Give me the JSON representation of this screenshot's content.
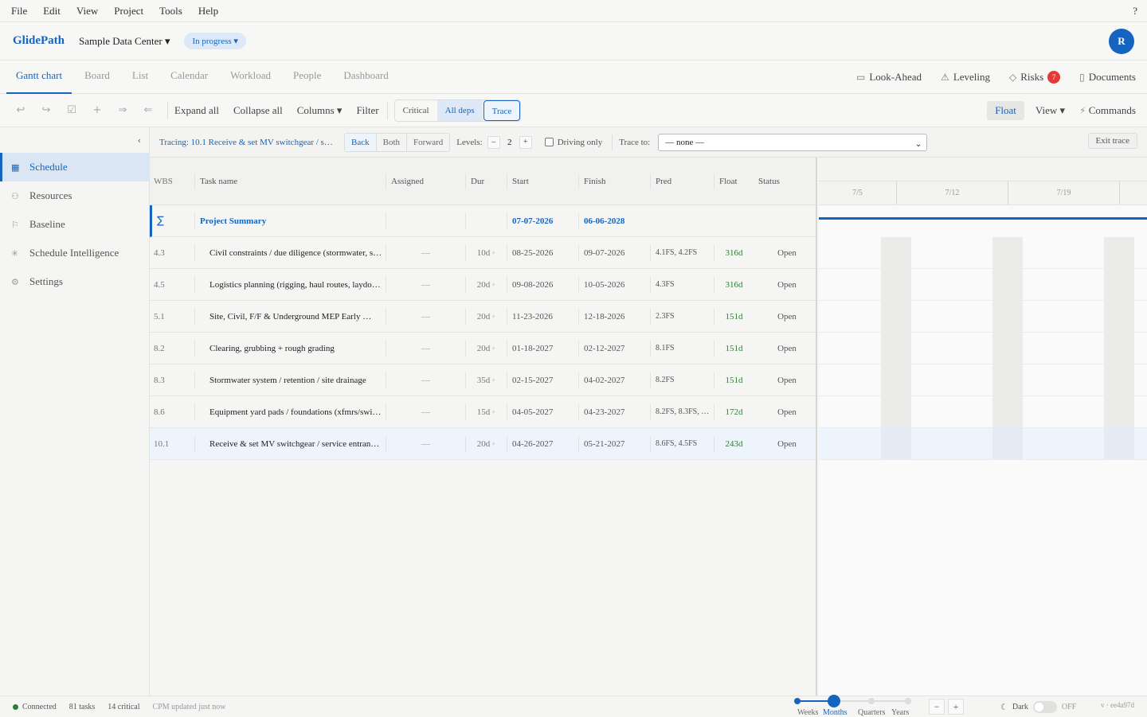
{
  "menu": {
    "items": [
      "File",
      "Edit",
      "View",
      "Project",
      "Tools",
      "Help"
    ],
    "help": "?"
  },
  "header": {
    "brand": "GlidePath",
    "project": "Sample Data Center ▾",
    "status": "In progress ▾",
    "avatar": "R"
  },
  "tabs": [
    "Gantt chart",
    "Board",
    "List",
    "Calendar",
    "Workload",
    "People",
    "Dashboard"
  ],
  "right_tools": {
    "lookahead": "Look-Ahead",
    "leveling": "Leveling",
    "risks": "Risks",
    "risks_count": "7",
    "documents": "Documents"
  },
  "toolbar": {
    "expand_all": "Expand all",
    "collapse_all": "Collapse all",
    "columns": "Columns ▾",
    "filter": "Filter",
    "critical": "Critical",
    "all_deps": "All deps",
    "trace": "Trace",
    "float": "Float",
    "view": "View ▾",
    "commands": "Commands"
  },
  "sidebar": {
    "items": [
      "Schedule",
      "Resources",
      "Baseline",
      "Schedule Intelligence",
      "Settings"
    ]
  },
  "trace": {
    "label": "Tracing: 10.1 Receive & set MV switchgear / s…",
    "back": "Back",
    "both": "Both",
    "forward": "Forward",
    "levels_label": "Levels:",
    "levels_value": "2",
    "driving_only": "Driving only",
    "trace_to_label": "Trace to:",
    "trace_to_value": "— none —",
    "exit": "Exit trace"
  },
  "grid": {
    "headers": {
      "wbs": "WBS",
      "name": "Task name",
      "assigned": "Assigned",
      "dur": "Dur",
      "start": "Start",
      "finish": "Finish",
      "pred": "Pred",
      "float": "Float",
      "status": "Status"
    },
    "summary": {
      "icon": "∑",
      "name": "Project Summary",
      "start": "07-07-2026",
      "finish": "06-06-2028"
    },
    "rows": [
      {
        "wbs": "4.3",
        "name": "Civil constraints / due diligence (stormwater, s…",
        "assigned": "—",
        "dur": "10d",
        "start": "08-25-2026",
        "finish": "09-07-2026",
        "pred": "4.1FS, 4.2FS",
        "float": "316d",
        "status": "Open"
      },
      {
        "wbs": "4.5",
        "name": "Logistics planning (rigging, haul routes, laydo…",
        "assigned": "—",
        "dur": "20d",
        "start": "09-08-2026",
        "finish": "10-05-2026",
        "pred": "4.3FS",
        "float": "316d",
        "status": "Open"
      },
      {
        "wbs": "5.1",
        "name": "Site, Civil, F/F & Underground MEP  Early …",
        "assigned": "—",
        "dur": "20d",
        "start": "11-23-2026",
        "finish": "12-18-2026",
        "pred": "2.3FS",
        "float": "151d",
        "status": "Open"
      },
      {
        "wbs": "8.2",
        "name": "Clearing, grubbing + rough grading",
        "assigned": "—",
        "dur": "20d",
        "start": "01-18-2027",
        "finish": "02-12-2027",
        "pred": "8.1FS",
        "float": "151d",
        "status": "Open"
      },
      {
        "wbs": "8.3",
        "name": "Stormwater system / retention / site drainage",
        "assigned": "—",
        "dur": "35d",
        "start": "02-15-2027",
        "finish": "04-02-2027",
        "pred": "8.2FS",
        "float": "151d",
        "status": "Open"
      },
      {
        "wbs": "8.6",
        "name": "Equipment yard pads / foundations (xfmrs/swi…",
        "assigned": "—",
        "dur": "15d",
        "start": "04-05-2027",
        "finish": "04-23-2027",
        "pred": "8.2FS, 8.3FS, …",
        "float": "172d",
        "status": "Open"
      },
      {
        "wbs": "10.1",
        "name": "Receive & set MV switchgear / service entran…",
        "assigned": "—",
        "dur": "20d",
        "start": "04-26-2027",
        "finish": "05-21-2027",
        "pred": "8.6FS, 4.5FS",
        "float": "243d",
        "status": "Open"
      }
    ]
  },
  "gantt": {
    "weeks": [
      "7/5",
      "7/12",
      "7/19",
      ""
    ]
  },
  "statusbar": {
    "connected": "Connected",
    "tasks": "81 tasks",
    "critical": "14 critical",
    "cpm": "CPM updated just now",
    "zoom_labels": [
      "Weeks",
      "Months",
      "Quarters",
      "Years"
    ],
    "zoom_minus": "−",
    "zoom_plus": "+",
    "dark": "Dark",
    "dark_state": "OFF",
    "version": "v · ee4a97d"
  },
  "colors": {
    "accent": "#1565c0",
    "float_green": "#2e7d32",
    "badge_red": "#e53935"
  }
}
